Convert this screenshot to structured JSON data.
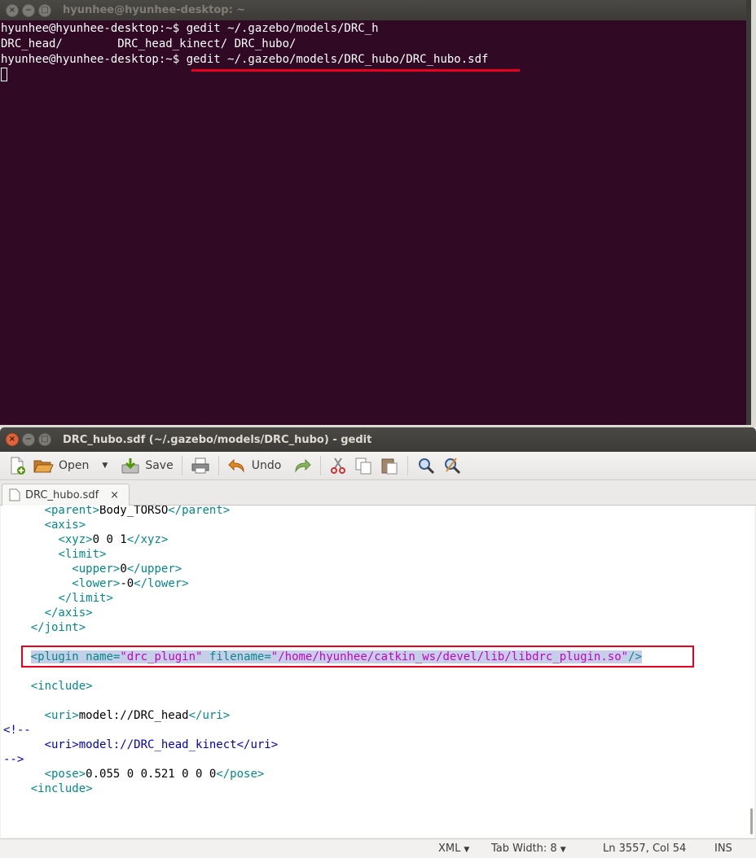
{
  "terminal": {
    "title": "hyunhee@hyunhee-desktop: ~",
    "lines": [
      "hyunhee@hyunhee-desktop:~$ gedit ~/.gazebo/models/DRC_h",
      "DRC_head/        DRC_head_kinect/ DRC_hubo/",
      "hyunhee@hyunhee-desktop:~$ gedit ~/.gazebo/models/DRC_hubo/DRC_hubo.sdf"
    ]
  },
  "gedit": {
    "title": "DRC_hubo.sdf (~/.gazebo/models/DRC_hubo) - gedit",
    "toolbar": {
      "open_label": "Open",
      "save_label": "Save",
      "undo_label": "Undo"
    },
    "tab": {
      "label": "DRC_hubo.sdf",
      "close": "×"
    },
    "code": {
      "parent_open": "<parent>",
      "parent_text": "Body_TORSO",
      "parent_close": "</parent>",
      "axis_open": "<axis>",
      "xyz_open": "<xyz>",
      "xyz_text": "0 0 1",
      "xyz_close": "</xyz>",
      "limit_open": "<limit>",
      "upper_open": "<upper>",
      "upper_text": "0",
      "upper_close": "</upper>",
      "lower_open": "<lower>",
      "lower_text": "-0",
      "lower_close": "</lower>",
      "limit_close": "</limit>",
      "axis_close": "</axis>",
      "joint_close": "</joint>",
      "plugin_tag": "<plugin",
      "plugin_name_attr": "name=",
      "plugin_name_val": "\"drc_plugin\"",
      "plugin_file_attr": "filename=",
      "plugin_file_val": "\"/home/hyunhee/catkin_ws/devel/lib/libdrc_plugin.so\"",
      "plugin_end": "/>",
      "include_open": "<include>",
      "uri_open": "<uri>",
      "uri_text": "model://DRC_head",
      "uri_close": "</uri>",
      "comment_open": "<!--",
      "uri2_line": "<uri>model://DRC_head_kinect</uri>",
      "comment_close": "-->",
      "pose_open": "<pose>",
      "pose_text": "0.055 0 0.521 0 0 0",
      "pose_close": "</pose>",
      "include_close": "<include>"
    },
    "status": {
      "language": "XML",
      "tab_width": "Tab Width: 8",
      "position": "Ln 3557, Col 54",
      "mode": "INS"
    }
  },
  "colors": {
    "terminal_bg": "#300a24",
    "highlight_box": "#e8001c",
    "xml_tag": "#008a8c",
    "xml_value": "#c800c8",
    "comment": "#0000c8"
  }
}
